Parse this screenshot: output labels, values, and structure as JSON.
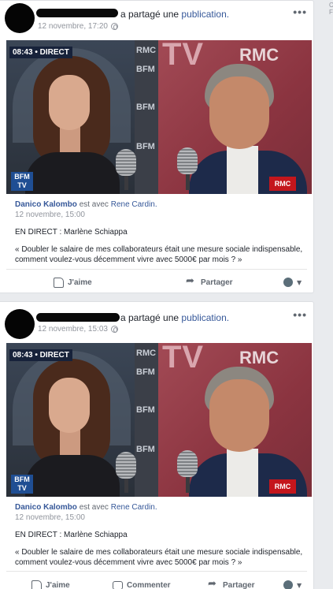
{
  "posts": [
    {
      "share_suffix": "a partagé une",
      "share_link": "publication.",
      "timestamp": "12 novembre, 17:20",
      "video_badge": "08:43 • DIRECT",
      "author": "Danico Kalombo",
      "with_text": "est avec",
      "tagged": "Rene Cardin.",
      "inner_time": "12 novembre, 15:00",
      "line1": "EN DIRECT : Marlène Schiappa",
      "quote": "« Doubler le salaire de mes collaborateurs était une mesure sociale indispensable, comment voulez-vous décemment vivre avec 5000€ par mois ? »",
      "actions": {
        "like": "J'aime",
        "share": "Partager"
      }
    },
    {
      "share_suffix": "a partagé une",
      "share_link": "publication.",
      "timestamp": "12 novembre, 15:03",
      "video_badge": "08:43 • DIRECT",
      "author": "Danico Kalombo",
      "with_text": "est avec",
      "tagged": "Rene Cardin.",
      "inner_time": "12 novembre, 15:00",
      "line1": "EN DIRECT : Marlène Schiappa",
      "quote": "« Doubler le salaire de mes collaborateurs était une mesure sociale indispensable, comment voulez-vous décemment vivre avec 5000€ par mois ? »",
      "actions": {
        "like": "J'aime",
        "comment": "Commenter",
        "share": "Partager"
      }
    }
  ],
  "video_overlay": {
    "tv": "TV",
    "rmc": "RMC",
    "bfm": "BFM",
    "rmc_logo": "RMC",
    "bfm_logo": "BFM TV"
  },
  "edge_text": "C\nF"
}
